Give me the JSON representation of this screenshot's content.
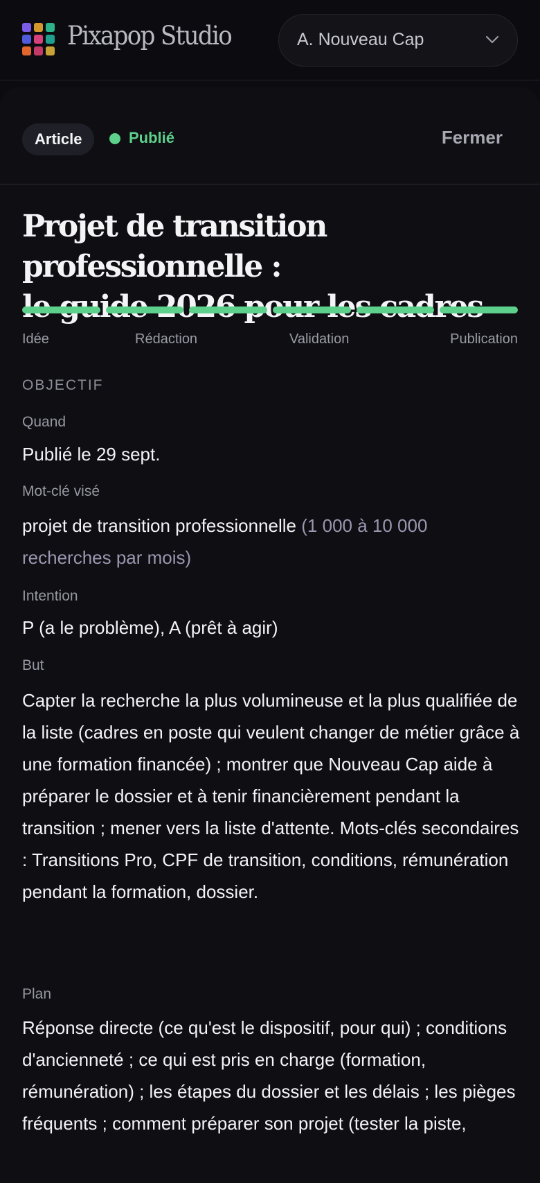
{
  "header": {
    "brand": "Pixapop Studio",
    "workspace": "A. Nouveau Cap",
    "logo_colors": [
      "#7b5ce6",
      "#d29a2e",
      "#2bb38a",
      "#4f5bd9",
      "#d6417c",
      "#1fa08f",
      "#e0662d",
      "#c23b68",
      "#c9a236"
    ]
  },
  "panel": {
    "type_chip": "Article",
    "status": "Publié",
    "close_label": "Fermer",
    "title_line1": "Projet de transition professionnelle :",
    "title_line2": "le guide 2026 pour les cadres"
  },
  "workflow": {
    "progress_segments": 6,
    "steps": [
      "Idée",
      "Rédaction",
      "Validation",
      "Publication"
    ]
  },
  "objective": {
    "section_title": "OBJECTIF",
    "when_label": "Quand",
    "when_value": "Publié le 29 sept.",
    "keyword_label": "Mot-clé visé",
    "keyword_value": "projet de transition professionnelle",
    "keyword_volume": "(1 000 à 10 000 recherches par mois)",
    "intent_label": "Intention",
    "intent_value": "P (a le problème), A (prêt à agir)",
    "goal_label": "But",
    "goal_value": "Capter la recherche la plus volumineuse et la plus qualifiée de la liste (cadres en poste qui veulent changer de métier grâce à une formation financée) ; montrer que Nouveau Cap aide à préparer le dossier et à tenir financièrement pendant la transition ; mener vers la liste d'attente. Mots-clés secondaires : Transitions Pro, CPF de transition, conditions, rémunération pendant la formation, dossier.",
    "plan_label": "Plan",
    "plan_value": "Réponse directe (ce qu'est le dispositif, pour qui) ; conditions d'ancienneté ; ce qui est pris en charge (formation, rémunération) ; les étapes du dossier et les délais ; les pièges fréquents ; comment préparer son projet (tester la piste,"
  },
  "colors": {
    "accent": "#5dd08b",
    "background": "#0c0c10"
  }
}
